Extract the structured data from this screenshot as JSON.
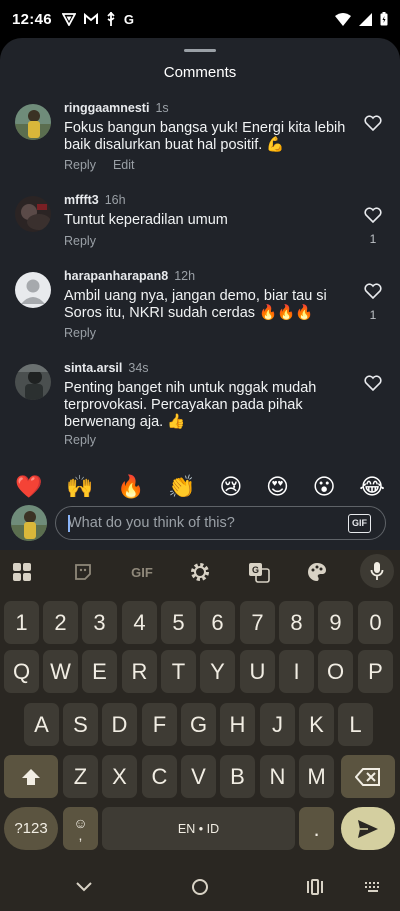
{
  "status": {
    "time": "12:46",
    "left_icons": [
      "vpn-icon",
      "gmail-icon",
      "usb-icon",
      "google-icon"
    ],
    "right_icons": [
      "wifi-icon",
      "signal-icon",
      "battery-icon"
    ],
    "g_letter": "G"
  },
  "sheet": {
    "title": "Comments"
  },
  "comments": [
    {
      "user": "ringgaamnesti",
      "time": "1s",
      "text": "Fokus bangun bangsa yuk! Energi kita lebih baik disalurkan buat hal positif. 💪",
      "actions": [
        "Reply",
        "Edit"
      ],
      "likes": ""
    },
    {
      "user": "mffft3",
      "time": "16h",
      "text": "Tuntut keperadilan umum",
      "actions": [
        "Reply"
      ],
      "likes": "1"
    },
    {
      "user": "harapanharapan8",
      "time": "12h",
      "text": "Ambil uang nya, jangan demo, biar tau si Soros itu, NKRI sudah cerdas 🔥🔥🔥",
      "actions": [
        "Reply"
      ],
      "likes": "1"
    },
    {
      "user": "sinta.arsil",
      "time": "34s",
      "text": "Penting banget nih untuk nggak mudah terprovokasi. Percayakan pada pihak berwenang aja. 👍",
      "actions": [
        "Reply"
      ],
      "likes": ""
    }
  ],
  "emoji_bar": [
    "❤️",
    "🙌",
    "🔥",
    "👏",
    "😢",
    "😍",
    "😮",
    "😂"
  ],
  "composer": {
    "placeholder": "What do you think of this?",
    "gif_label": "GIF"
  },
  "keyboard": {
    "toolbar": {
      "gif_label": "GIF"
    },
    "rows": [
      [
        "1",
        "2",
        "3",
        "4",
        "5",
        "6",
        "7",
        "8",
        "9",
        "0"
      ],
      [
        "Q",
        "W",
        "E",
        "R",
        "T",
        "Y",
        "U",
        "I",
        "O",
        "P"
      ],
      [
        "A",
        "S",
        "D",
        "F",
        "G",
        "H",
        "J",
        "K",
        "L"
      ],
      [
        "Z",
        "X",
        "C",
        "V",
        "B",
        "N",
        "M"
      ]
    ],
    "symbols_label": "?123",
    "space_label": "EN • ID",
    "comma_label": ",",
    "period_label": ".",
    "emoji_key": "☺"
  },
  "colors": {
    "sheet_bg": "#202329",
    "keyboard_bg": "#2a2722",
    "key_bg": "#3e3b34",
    "fn_key_bg": "#5b5440",
    "enter_bg": "#d4cfa0",
    "accent": "#8ab4f8"
  }
}
